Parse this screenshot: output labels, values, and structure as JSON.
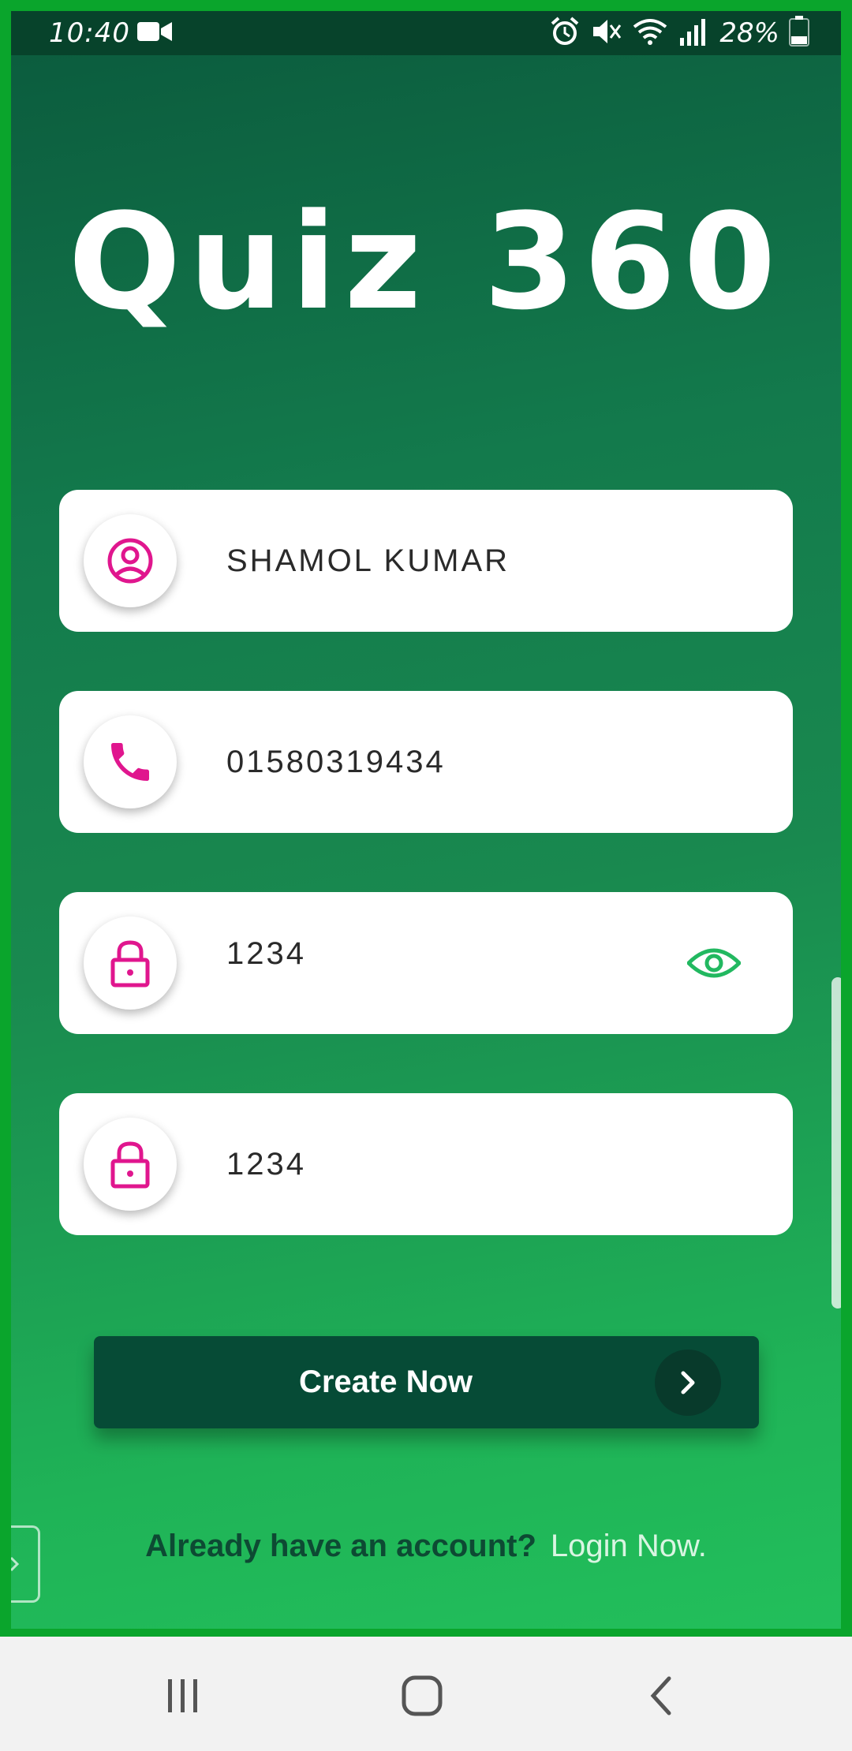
{
  "status_bar": {
    "time": "10:40",
    "battery": "28%",
    "icons": [
      "video-icon",
      "alarm-icon",
      "mute-icon",
      "wifi-icon",
      "signal-icon",
      "battery-icon"
    ]
  },
  "app": {
    "title": "Quiz 360"
  },
  "form": {
    "name_value": "SHAMOL KUMAR",
    "phone_value": "01580319434",
    "password_value": "1234",
    "confirm_password_value": "1234"
  },
  "actions": {
    "create_label": "Create Now",
    "already_text": "Already have an account?",
    "login_link": "Login Now."
  },
  "colors": {
    "brand_green": "#1a8a4f",
    "dark_green": "#064b36",
    "icon_accent": "#e0168e",
    "eye_icon": "#22b860"
  },
  "nav": {
    "items": [
      "recent-apps-icon",
      "home-icon",
      "back-icon"
    ]
  }
}
